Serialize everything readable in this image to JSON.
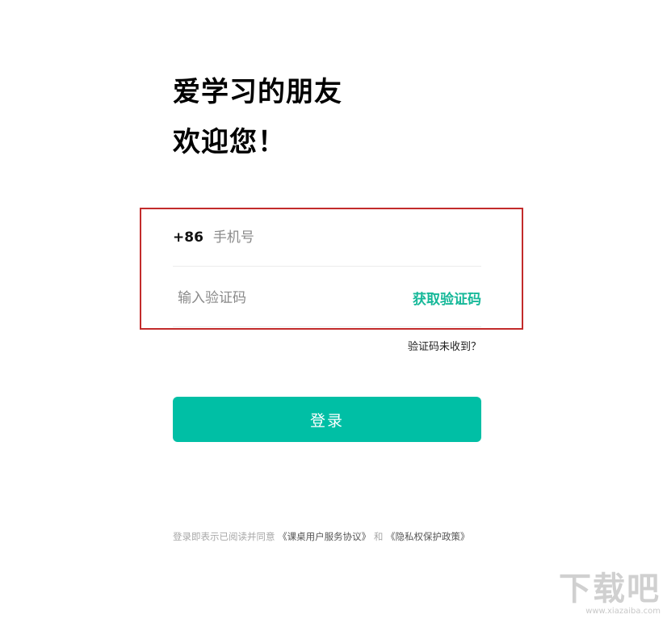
{
  "welcome": {
    "line1": "爱学习的朋友",
    "line2": "欢迎您！"
  },
  "login_form": {
    "country_code": "+86",
    "phone_placeholder": "手机号",
    "code_placeholder": "输入验证码",
    "get_code_label": "获取验证码",
    "no_code_label": "验证码未收到？",
    "login_label": "登录"
  },
  "agreement": {
    "prefix": "登录即表示已阅读并同意",
    "service_link": "《课桌用户服务协议》",
    "and": "和",
    "privacy_link": "《隐私权保护政策》"
  },
  "watermark": {
    "logo": "下载吧",
    "site": "www.xiazaiba.com"
  },
  "colors": {
    "accent": "#00bfa5",
    "get_code_text": "#16b899",
    "highlight_border": "#c22b2b"
  }
}
